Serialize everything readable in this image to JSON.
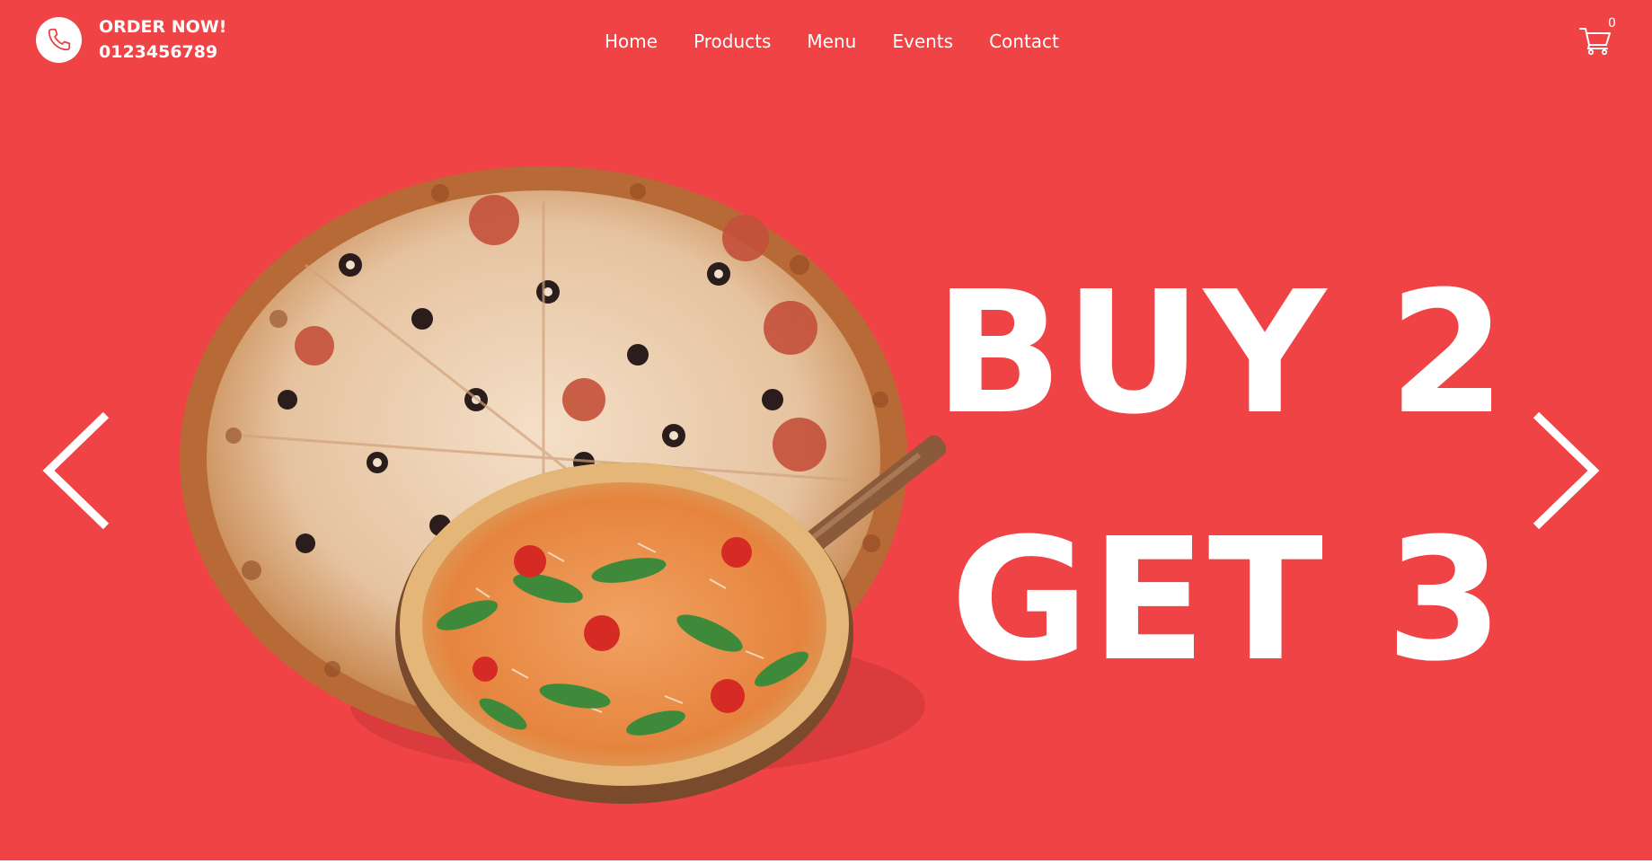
{
  "header": {
    "order_label": "ORDER NOW!",
    "phone": "0123456789",
    "nav": [
      "Home",
      "Products",
      "Menu",
      "Events",
      "Contact"
    ],
    "cart_count": "0"
  },
  "hero": {
    "line1": "BUY 2",
    "line2": "GET 3"
  },
  "icons": {
    "phone": "phone-icon",
    "cart": "cart-icon",
    "prev": "chevron-left-icon",
    "next": "chevron-right-icon"
  },
  "colors": {
    "background": "#ef4346",
    "text": "#ffffff",
    "phone_icon": "#e8403f"
  }
}
